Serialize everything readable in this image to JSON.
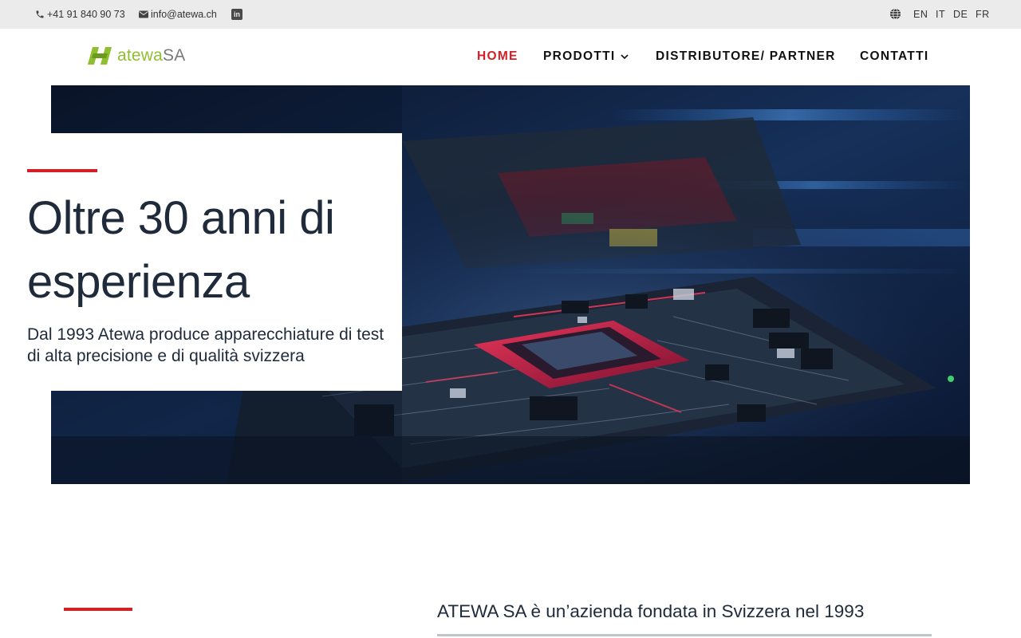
{
  "topbar": {
    "phone": "+41 91 840 90 73",
    "email": "info@atewa.ch",
    "linkedin_icon": "linkedin-icon",
    "globe_icon": "globe-icon",
    "languages": [
      "EN",
      "IT",
      "DE",
      "FR"
    ]
  },
  "logo": {
    "mark_icon": "atewa-logo-mark",
    "text": "atewa",
    "suffix": "SA",
    "colors": {
      "green": "#8fbf2f",
      "gray": "#7a7a7a"
    }
  },
  "nav": {
    "items": [
      {
        "label": "HOME",
        "active": true
      },
      {
        "label": "PRODOTTI",
        "dropdown": true
      },
      {
        "label": "DISTRIBUTORE/ PARTNER"
      },
      {
        "label": "CONTATTI"
      }
    ],
    "active_color": "#d32028"
  },
  "hero": {
    "title": "Oltre 30 anni di esperienza",
    "subtitle": "Dal 1993 Atewa produce apparecchiature di test di alta precisione e di qualità svizzera",
    "image": "circuit-board-photo",
    "accent_color": "#d32028"
  },
  "about": {
    "text": "ATEWA SA è un’azienda fondata in Svizzera nel 1993"
  }
}
